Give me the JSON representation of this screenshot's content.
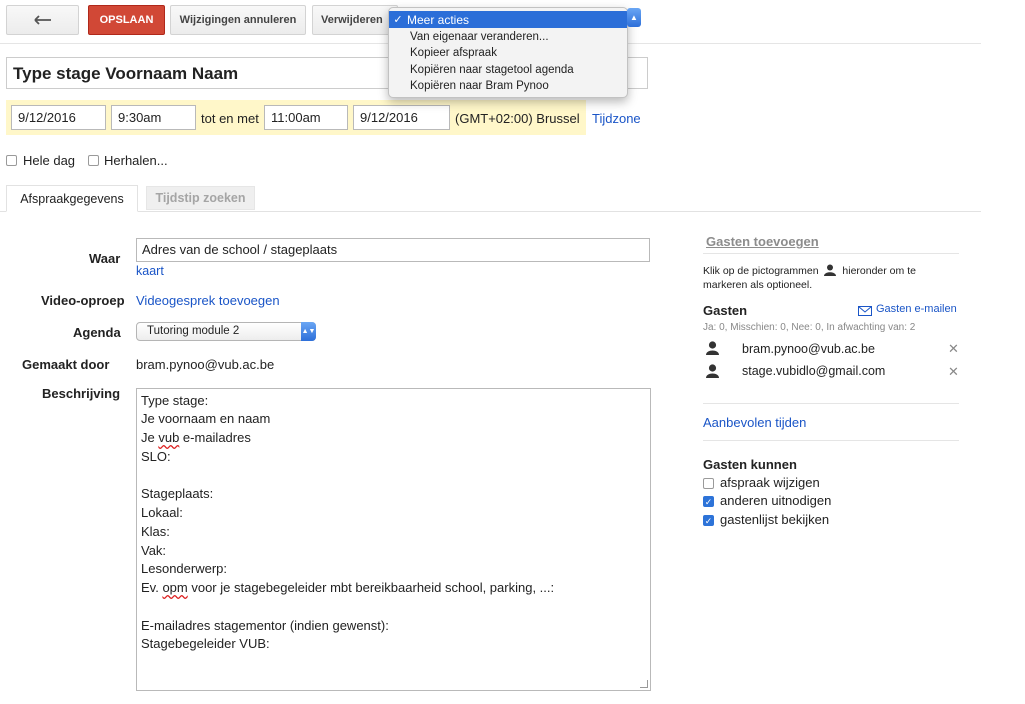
{
  "toolbar": {
    "back_icon": "back-arrow-icon",
    "save_label": "OPSLAAN",
    "cancel_label": "Wijzigingen annuleren",
    "delete_label": "Verwijderen",
    "save_color": "#d14836"
  },
  "more_menu": {
    "selected": "Meer acties",
    "items": [
      "Van eigenaar veranderen...",
      "Kopieer afspraak",
      "Kopiëren naar stagetool agenda",
      "Kopiëren naar Bram Pynoo"
    ],
    "highlight_color": "#2b6ed8"
  },
  "event": {
    "title": "Type stage Voornaam Naam",
    "start_date": "9/12/2016",
    "start_time": "9:30am",
    "range_sep": "tot en met",
    "end_time": "11:00am",
    "end_date": "9/12/2016",
    "timezone": "(GMT+02:00) Brussel",
    "timezone_link": "Tijdzone",
    "all_day_label": "Hele dag",
    "repeat_label": "Herhalen..."
  },
  "tabs": [
    {
      "label": "Afspraakgegevens"
    },
    {
      "label": "Tijdstip zoeken"
    }
  ],
  "form": {
    "where_label": "Waar",
    "where_value": "Adres van de school / stageplaats",
    "map_link": "kaart",
    "video_label": "Video-oproep",
    "video_link": "Videogesprek toevoegen",
    "calendar_label": "Agenda",
    "calendar_value": "Tutoring module 2",
    "created_by_label": "Gemaakt door",
    "created_by_value": "bram.pynoo@vub.ac.be",
    "description_label": "Beschrijving",
    "description_lines": [
      "Type stage:",
      "Je voornaam en naam",
      "Je vub e-mailadres",
      "SLO:",
      "",
      "Stageplaats:",
      "Lokaal:",
      "Klas:",
      "Vak:",
      "Lesonderwerp:",
      "Ev. opm voor je stagebegeleider mbt bereikbaarheid school, parking, ...:",
      "",
      "E-mailadres stagementor (indien gewenst):",
      "Stagebegeleider VUB:"
    ]
  },
  "guests": {
    "add_label": "Gasten toevoegen",
    "hint_before": "Klik op de pictogrammen",
    "hint_after": "hieronder om te",
    "hint_line2": "markeren als optioneel.",
    "heading": "Gasten",
    "email_link": "Gasten e-mailen",
    "rsvp_summary": "Ja: 0, Misschien: 0, Nee: 0, In afwachting van: 2",
    "list": [
      {
        "email": "bram.pynoo@vub.ac.be"
      },
      {
        "email": "stage.vubidlo@gmail.com"
      }
    ],
    "suggested_times": "Aanbevolen tijden",
    "can_heading": "Gasten kunnen",
    "permissions": [
      {
        "label": "afspraak wijzigen",
        "checked": false
      },
      {
        "label": "anderen uitnodigen",
        "checked": true
      },
      {
        "label": "gastenlijst bekijken",
        "checked": true
      }
    ]
  }
}
